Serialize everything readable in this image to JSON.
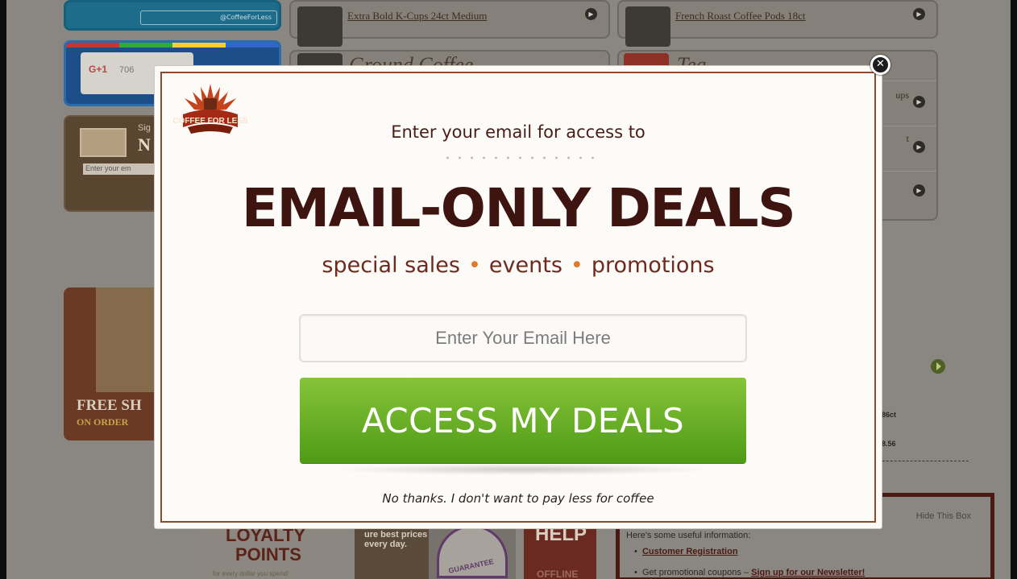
{
  "background": {
    "twitter_handle": "@CoffeeForLess",
    "gplus_button": "G+1",
    "gplus_count": "706",
    "signup_text": "Sig",
    "signup_big": "N",
    "signup_placeholder": "Enter your em",
    "products": [
      {
        "label": "Extra Bold K-Cups 24ct Medium"
      },
      {
        "label": "French Roast Coffee Pods 18ct"
      }
    ],
    "category_ground": "Ground Coffee",
    "category_tea": "Tea",
    "tea_rows": [
      "ups",
      "t",
      ""
    ],
    "free_shipping": "FREE SH",
    "on_orders": "ON ORDER",
    "side_texts": [
      "86ct",
      "8.56"
    ],
    "info_box": {
      "hide_label": "Hide This Box",
      "useful": "Here's some useful information:",
      "items": [
        {
          "text": "",
          "link": "Customer Registration"
        },
        {
          "text": "Get promotional coupons – ",
          "link": "Sign up for our Newsletter!"
        }
      ]
    },
    "loyalty": {
      "line1": "LOYALTY",
      "line2": "POINTS",
      "line3": "for every dollar you spend!"
    },
    "prices": "ure best prices every day.",
    "guarantee": "GUARANTEE",
    "help": {
      "line1": "HELP",
      "line2": "OFFLINE"
    }
  },
  "modal": {
    "logo_text": "COFFEE FOR LESS",
    "subhead": "Enter your email for access to",
    "headline": "EMAIL-ONLY DEALS",
    "tagline": {
      "part1": "special sales",
      "part2": "events",
      "part3": "promotions",
      "bullet": "•"
    },
    "email_placeholder": "Enter Your Email Here",
    "cta_label": "ACCESS MY DEALS",
    "decline_label": "No thanks. I don't want to pay less for coffee",
    "close_label": "✕",
    "colors": {
      "headline": "#3e1410",
      "accent": "#e2792a",
      "cta": "#6cb22a",
      "frame": "#8c4a2c"
    }
  }
}
